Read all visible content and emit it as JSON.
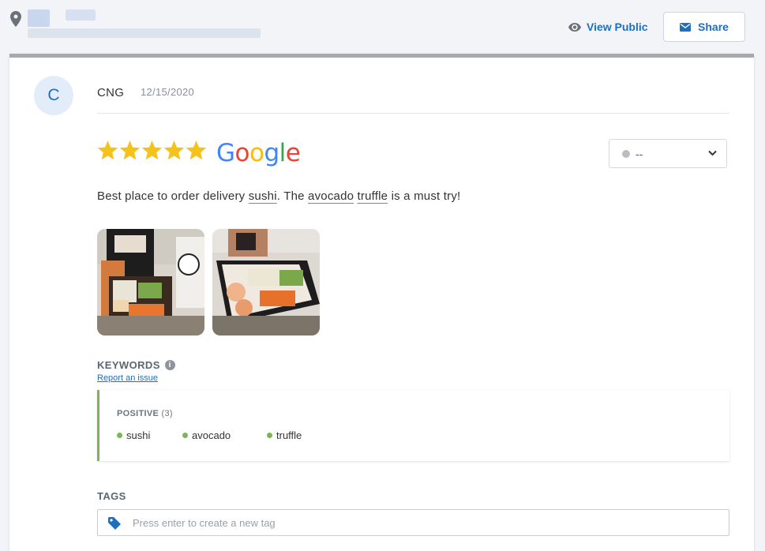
{
  "header": {
    "view_public_label": "View Public",
    "share_label": "Share"
  },
  "review": {
    "avatar_initial": "C",
    "author": "CNG",
    "date": "12/15/2020",
    "rating": 5,
    "rating_max": 5,
    "source": "Google",
    "status_value": "--",
    "text_parts": [
      "Best place to order delivery ",
      "sushi",
      ". The ",
      "avocado",
      " ",
      "truffle",
      " is a must try!"
    ]
  },
  "keywords": {
    "heading": "KEYWORDS",
    "report_link": "Report an issue",
    "sentiment_label": "POSITIVE",
    "count_label": "(3)",
    "items": [
      "sushi",
      "avocado",
      "truffle"
    ]
  },
  "tags": {
    "heading": "TAGS",
    "placeholder": "Press enter to create a new tag"
  },
  "colors": {
    "accent": "#1f6fbd",
    "star": "#f5c21b",
    "positive": "#7fb35a"
  }
}
